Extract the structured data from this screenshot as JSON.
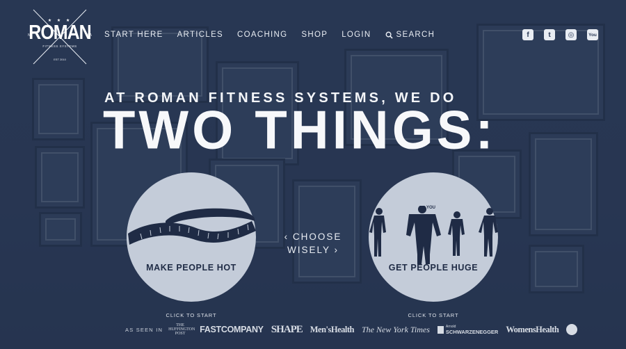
{
  "brand": {
    "name": "ROMAN",
    "tagline": "FITNESS SYSTEMS",
    "city_left": "NY",
    "city_right": "LA",
    "established": "EST 2010",
    "stars": "★ ★ ★"
  },
  "nav": {
    "items": [
      {
        "label": "START HERE"
      },
      {
        "label": "ARTICLES"
      },
      {
        "label": "COACHING"
      },
      {
        "label": "SHOP"
      },
      {
        "label": "LOGIN"
      }
    ],
    "search_label": "SEARCH"
  },
  "social": {
    "facebook": "f",
    "twitter": "t",
    "instagram": "◎",
    "youtube": "You"
  },
  "hero": {
    "kicker": "AT ROMAN FITNESS SYSTEMS, WE DO",
    "headline": "TWO THINGS:"
  },
  "choices": {
    "left": {
      "label": "MAKE PEOPLE HOT",
      "cta": "CLICK TO START",
      "icon": "tape-measure-icon"
    },
    "right": {
      "label": "GET PEOPLE HUGE",
      "cta": "CLICK TO START",
      "icon": "body-silhouettes-icon",
      "you_label": "YOU"
    },
    "prompt_line1": "‹ CHOOSE",
    "prompt_line2": "WISELY ›"
  },
  "press": {
    "intro": "AS SEEN IN",
    "outlets": {
      "huffington": "THE HUFFINGTON POST",
      "fastcompany": "FASTCOMPANY",
      "shape": "SHAPE",
      "menshealth": "Men'sHealth",
      "nyt": "The New York Times",
      "arnold_small": "Arnold",
      "arnold": "SCHWARZENEGGER",
      "womenshealth": "WomensHealth",
      "abc": "abc"
    }
  },
  "colors": {
    "background": "#2a3956",
    "circle": "#c4ccd9",
    "circle_ink": "#1f2b45",
    "text": "#f4f6f9"
  }
}
